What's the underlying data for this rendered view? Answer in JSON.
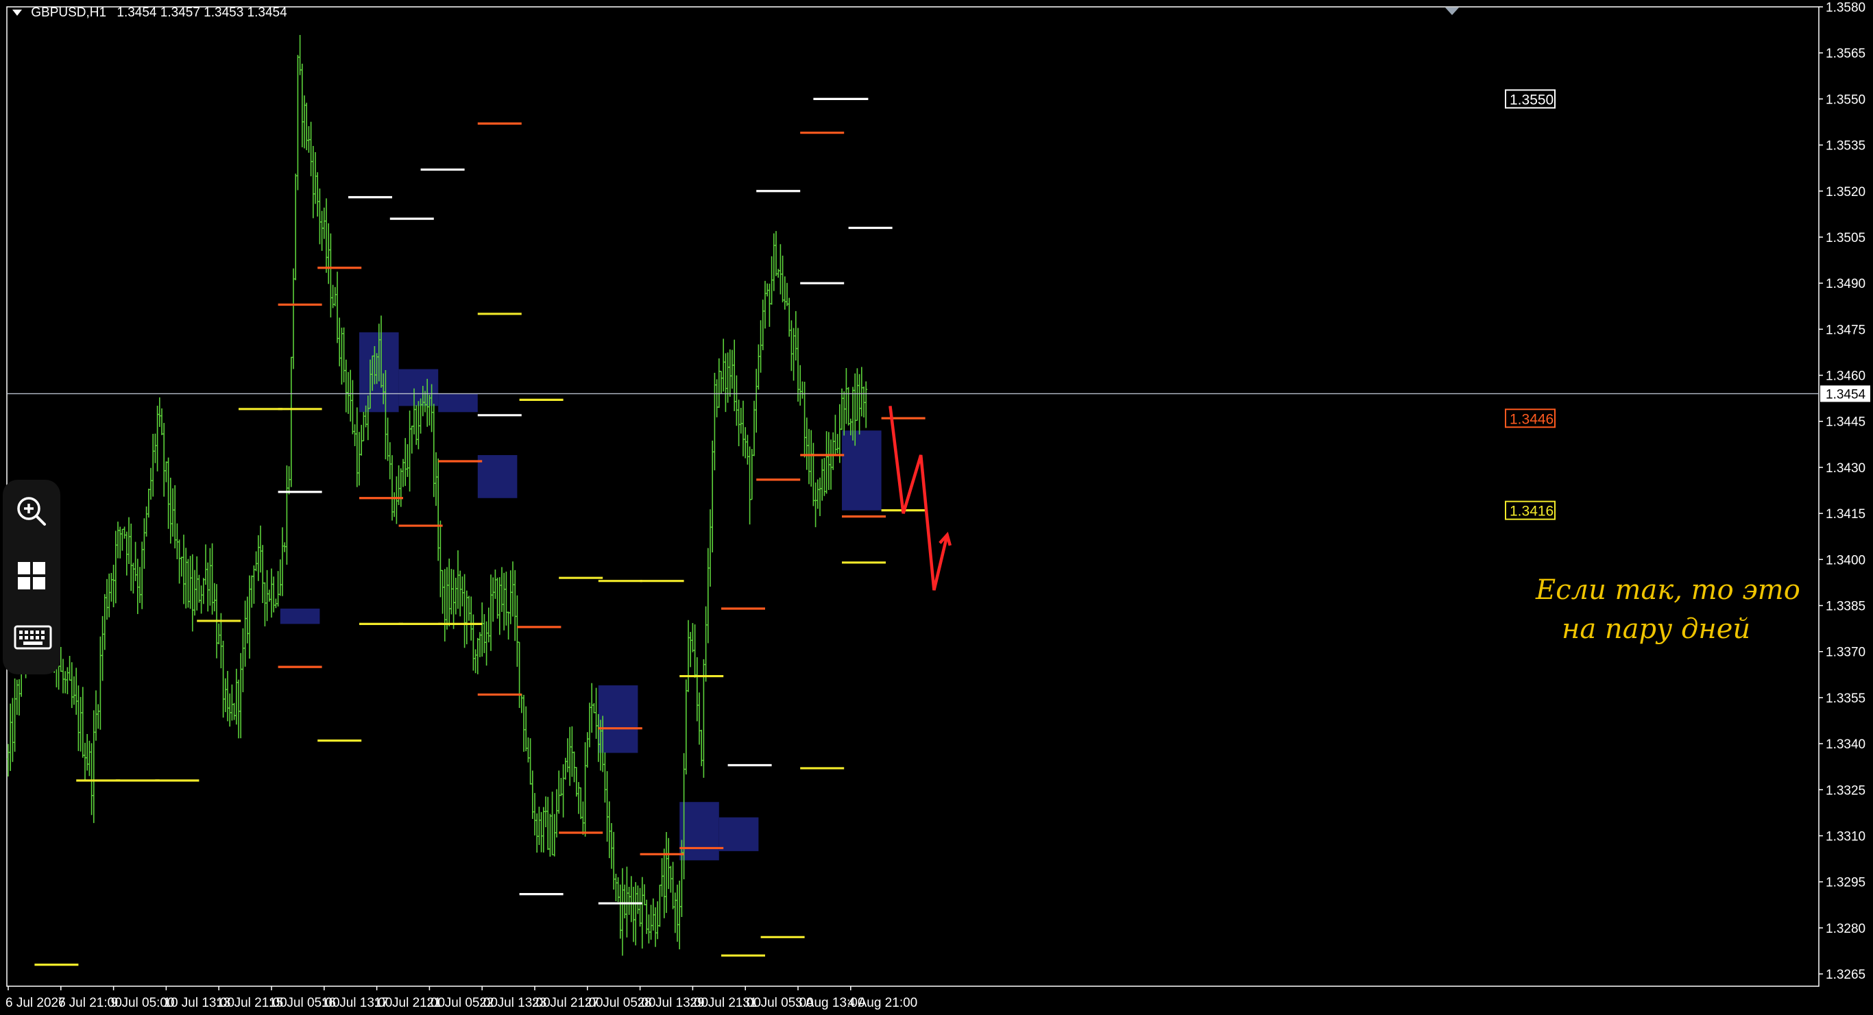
{
  "header": {
    "symbol": "GBPUSD,H1",
    "quote": "1.3454 1.3457 1.3453 1.3454"
  },
  "colors": {
    "background": "#000000",
    "candles": "#5cd13a",
    "grid": "#ffffff",
    "level_white": "#ffffff",
    "level_yellow": "#f2ea2a",
    "level_orange": "#ff5a1f",
    "zone": "#1a1f6e",
    "annotation": "#ff2424",
    "note": "#f0c400"
  },
  "toolbar": {
    "icons": [
      "zoom-in-icon",
      "grid-icon",
      "keyboard-icon"
    ]
  },
  "annotations": {
    "note_line1": "Если так, то это",
    "note_line2": "на пару дней"
  },
  "chart_data": {
    "type": "line",
    "style": "ohlc-bars",
    "ylim": [
      1.3261,
      1.358
    ],
    "y_ticks": [
      "1.3580",
      "1.3565",
      "1.3550",
      "1.3535",
      "1.3520",
      "1.3505",
      "1.3490",
      "1.3475",
      "1.3460",
      "1.3445",
      "1.3430",
      "1.3415",
      "1.3400",
      "1.3385",
      "1.3370",
      "1.3355",
      "1.3340",
      "1.3325",
      "1.3310",
      "1.3295",
      "1.3280",
      "1.3265"
    ],
    "current_price": "1.3454",
    "price_labels": [
      {
        "text": "1.3550",
        "value": 1.355,
        "color": "#ffffff"
      },
      {
        "text": "1.3446",
        "value": 1.3446,
        "color": "#ff5a1f"
      },
      {
        "text": "1.3416",
        "value": 1.3416,
        "color": "#f2ea2a"
      }
    ],
    "x_labels": [
      "6 Jul 2026",
      "7 Jul 21:00",
      "9 Jul 05:00",
      "10 Jul 13:00",
      "13 Jul 21:00",
      "15 Jul 05:00",
      "16 Jul 13:00",
      "17 Jul 21:00",
      "21 Jul 05:00",
      "22 Jul 13:00",
      "23 Jul 21:00",
      "27 Jul 05:00",
      "28 Jul 13:00",
      "29 Jul 21:00",
      "31 Jul 05:00",
      "3 Aug 13:00",
      "4 Aug 21:00"
    ],
    "x_label_index": [
      0,
      24,
      48,
      72,
      96,
      120,
      144,
      168,
      192,
      216,
      240,
      264,
      288,
      312,
      336,
      360,
      384
    ],
    "n_bars": 392,
    "path_anchors": [
      [
        0,
        1.3335
      ],
      [
        8,
        1.3375
      ],
      [
        16,
        1.339
      ],
      [
        24,
        1.3362
      ],
      [
        32,
        1.3348
      ],
      [
        38,
        1.333
      ],
      [
        44,
        1.3385
      ],
      [
        52,
        1.3412
      ],
      [
        60,
        1.3392
      ],
      [
        68,
        1.3446
      ],
      [
        76,
        1.3404
      ],
      [
        84,
        1.3386
      ],
      [
        92,
        1.3398
      ],
      [
        100,
        1.3345
      ],
      [
        106,
        1.336
      ],
      [
        112,
        1.3402
      ],
      [
        118,
        1.339
      ],
      [
        124,
        1.3392
      ],
      [
        128,
        1.343
      ],
      [
        132,
        1.3558
      ],
      [
        138,
        1.353
      ],
      [
        146,
        1.3495
      ],
      [
        152,
        1.3468
      ],
      [
        160,
        1.343
      ],
      [
        168,
        1.3472
      ],
      [
        176,
        1.3415
      ],
      [
        184,
        1.344
      ],
      [
        192,
        1.3455
      ],
      [
        198,
        1.3385
      ],
      [
        206,
        1.339
      ],
      [
        214,
        1.3368
      ],
      [
        222,
        1.3388
      ],
      [
        230,
        1.3386
      ],
      [
        234,
        1.3355
      ],
      [
        240,
        1.3315
      ],
      [
        248,
        1.331
      ],
      [
        256,
        1.3338
      ],
      [
        262,
        1.332
      ],
      [
        266,
        1.3358
      ],
      [
        272,
        1.333
      ],
      [
        278,
        1.3285
      ],
      [
        286,
        1.329
      ],
      [
        294,
        1.3282
      ],
      [
        300,
        1.3296
      ],
      [
        306,
        1.3284
      ],
      [
        310,
        1.3376
      ],
      [
        316,
        1.334
      ],
      [
        322,
        1.3455
      ],
      [
        330,
        1.3462
      ],
      [
        338,
        1.3425
      ],
      [
        344,
        1.3478
      ],
      [
        350,
        1.35
      ],
      [
        356,
        1.3475
      ],
      [
        362,
        1.345
      ],
      [
        368,
        1.342
      ],
      [
        374,
        1.343
      ],
      [
        380,
        1.3448
      ],
      [
        386,
        1.3452
      ],
      [
        391,
        1.3454
      ]
    ],
    "levels": [
      {
        "color": "white",
        "value": 1.355,
        "from": 367,
        "to": 392
      },
      {
        "color": "white",
        "value": 1.3527,
        "from": 188,
        "to": 208
      },
      {
        "color": "white",
        "value": 1.352,
        "from": 341,
        "to": 361
      },
      {
        "color": "white",
        "value": 1.3518,
        "from": 155,
        "to": 175
      },
      {
        "color": "white",
        "value": 1.3511,
        "from": 174,
        "to": 194
      },
      {
        "color": "white",
        "value": 1.3508,
        "from": 383,
        "to": 403
      },
      {
        "color": "white",
        "value": 1.349,
        "from": 361,
        "to": 381
      },
      {
        "color": "white",
        "value": 1.3447,
        "from": 214,
        "to": 234
      },
      {
        "color": "white",
        "value": 1.3422,
        "from": 123,
        "to": 143
      },
      {
        "color": "white",
        "value": 1.3333,
        "from": 328,
        "to": 348
      },
      {
        "color": "white",
        "value": 1.3291,
        "from": 233,
        "to": 253
      },
      {
        "color": "white",
        "value": 1.3288,
        "from": 269,
        "to": 289
      },
      {
        "color": "orange",
        "value": 1.3542,
        "from": 214,
        "to": 234
      },
      {
        "color": "orange",
        "value": 1.3539,
        "from": 361,
        "to": 381
      },
      {
        "color": "orange",
        "value": 1.3495,
        "from": 141,
        "to": 161
      },
      {
        "color": "orange",
        "value": 1.3483,
        "from": 123,
        "to": 143
      },
      {
        "color": "orange",
        "value": 1.3446,
        "from": 398,
        "to": 418
      },
      {
        "color": "orange",
        "value": 1.3434,
        "from": 361,
        "to": 381
      },
      {
        "color": "orange",
        "value": 1.3432,
        "from": 196,
        "to": 216
      },
      {
        "color": "orange",
        "value": 1.3426,
        "from": 341,
        "to": 361
      },
      {
        "color": "orange",
        "value": 1.342,
        "from": 160,
        "to": 180
      },
      {
        "color": "orange",
        "value": 1.3414,
        "from": 380,
        "to": 400
      },
      {
        "color": "orange",
        "value": 1.3411,
        "from": 178,
        "to": 198
      },
      {
        "color": "orange",
        "value": 1.3384,
        "from": 325,
        "to": 345
      },
      {
        "color": "orange",
        "value": 1.3378,
        "from": 232,
        "to": 252
      },
      {
        "color": "orange",
        "value": 1.3365,
        "from": 123,
        "to": 143
      },
      {
        "color": "orange",
        "value": 1.3356,
        "from": 214,
        "to": 234
      },
      {
        "color": "orange",
        "value": 1.3345,
        "from": 269,
        "to": 289
      },
      {
        "color": "orange",
        "value": 1.3311,
        "from": 251,
        "to": 271
      },
      {
        "color": "orange",
        "value": 1.3306,
        "from": 306,
        "to": 326
      },
      {
        "color": "orange",
        "value": 1.3304,
        "from": 288,
        "to": 308
      },
      {
        "color": "yellow",
        "value": 1.348,
        "from": 214,
        "to": 234
      },
      {
        "color": "yellow",
        "value": 1.3452,
        "from": 233,
        "to": 253
      },
      {
        "color": "yellow",
        "value": 1.3449,
        "from": 105,
        "to": 125
      },
      {
        "color": "yellow",
        "value": 1.3449,
        "from": 123,
        "to": 143
      },
      {
        "color": "yellow",
        "value": 1.3416,
        "from": 398,
        "to": 418
      },
      {
        "color": "yellow",
        "value": 1.3399,
        "from": 380,
        "to": 400
      },
      {
        "color": "yellow",
        "value": 1.3394,
        "from": 251,
        "to": 271
      },
      {
        "color": "yellow",
        "value": 1.3393,
        "from": 269,
        "to": 289
      },
      {
        "color": "yellow",
        "value": 1.3393,
        "from": 288,
        "to": 308
      },
      {
        "color": "yellow",
        "value": 1.338,
        "from": 86,
        "to": 106
      },
      {
        "color": "yellow",
        "value": 1.3379,
        "from": 160,
        "to": 180
      },
      {
        "color": "yellow",
        "value": 1.3379,
        "from": 178,
        "to": 198
      },
      {
        "color": "yellow",
        "value": 1.3379,
        "from": 196,
        "to": 216
      },
      {
        "color": "yellow",
        "value": 1.3362,
        "from": 306,
        "to": 326
      },
      {
        "color": "yellow",
        "value": 1.3341,
        "from": 141,
        "to": 161
      },
      {
        "color": "yellow",
        "value": 1.3332,
        "from": 361,
        "to": 381
      },
      {
        "color": "yellow",
        "value": 1.3328,
        "from": 31,
        "to": 51
      },
      {
        "color": "yellow",
        "value": 1.3328,
        "from": 49,
        "to": 69
      },
      {
        "color": "yellow",
        "value": 1.3328,
        "from": 67,
        "to": 87
      },
      {
        "color": "yellow",
        "value": 1.3277,
        "from": 343,
        "to": 363
      },
      {
        "color": "yellow",
        "value": 1.3271,
        "from": 325,
        "to": 345
      },
      {
        "color": "yellow",
        "value": 1.3268,
        "from": 12,
        "to": 32
      }
    ],
    "zones": [
      {
        "from": 124,
        "to": 142,
        "top": 1.3384,
        "bottom": 1.3379
      },
      {
        "from": 160,
        "to": 178,
        "top": 1.3474,
        "bottom": 1.3448
      },
      {
        "from": 178,
        "to": 196,
        "top": 1.3462,
        "bottom": 1.345
      },
      {
        "from": 196,
        "to": 214,
        "top": 1.3454,
        "bottom": 1.3448
      },
      {
        "from": 214,
        "to": 232,
        "top": 1.3434,
        "bottom": 1.342
      },
      {
        "from": 269,
        "to": 287,
        "top": 1.3359,
        "bottom": 1.3337
      },
      {
        "from": 306,
        "to": 324,
        "top": 1.3321,
        "bottom": 1.3302
      },
      {
        "from": 324,
        "to": 342,
        "top": 1.3316,
        "bottom": 1.3305
      },
      {
        "from": 380,
        "to": 398,
        "top": 1.3442,
        "bottom": 1.3416
      }
    ],
    "projection": [
      [
        402,
        1.345
      ],
      [
        408,
        1.3415
      ],
      [
        416,
        1.3434
      ],
      [
        422,
        1.339
      ],
      [
        428,
        1.3408
      ]
    ]
  }
}
